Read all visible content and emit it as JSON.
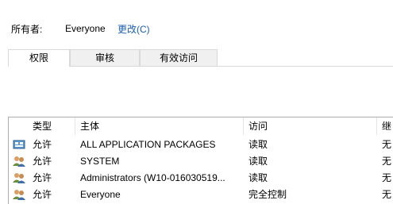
{
  "owner": {
    "label": "所有者:",
    "value": "Everyone",
    "change_link": "更改(C)"
  },
  "tabs": [
    {
      "label": "权限",
      "active": true
    },
    {
      "label": "审核",
      "active": false
    },
    {
      "label": "有效访问",
      "active": false
    }
  ],
  "table": {
    "headers": {
      "type": "类型",
      "principal": "主体",
      "access": "访问",
      "inherited": "继"
    },
    "rows": [
      {
        "icon": "package-icon",
        "type": "允许",
        "principal": "ALL APPLICATION PACKAGES",
        "access": "读取",
        "inherited": "无"
      },
      {
        "icon": "users-icon",
        "type": "允许",
        "principal": "SYSTEM",
        "access": "读取",
        "inherited": "无"
      },
      {
        "icon": "users-icon",
        "type": "允许",
        "principal": "Administrators (W10-016030519...",
        "access": "读取",
        "inherited": "无"
      },
      {
        "icon": "users-icon",
        "type": "允许",
        "principal": "Everyone",
        "access": "完全控制",
        "inherited": "无"
      }
    ]
  }
}
